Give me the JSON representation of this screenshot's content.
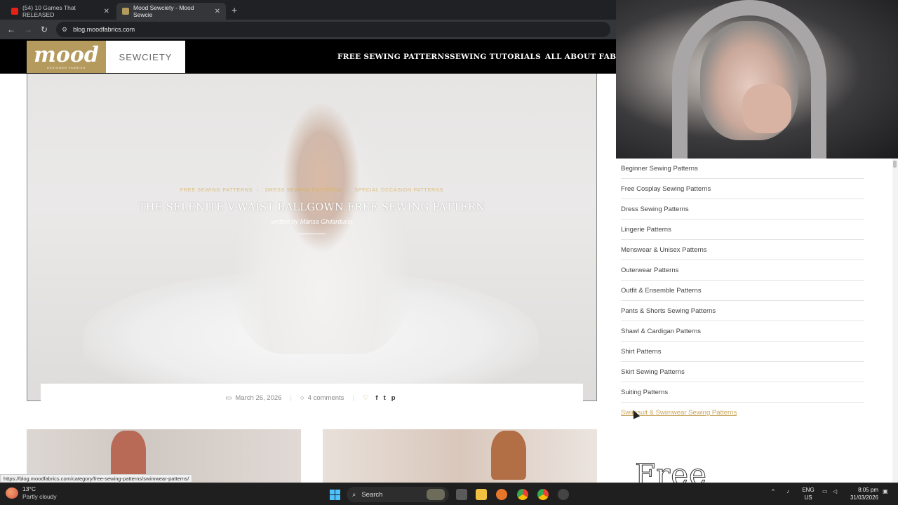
{
  "browser": {
    "tabs": [
      {
        "label": "(54) 10 Games That RELEASED",
        "close": "✕"
      },
      {
        "label": "Mood Sewciety - Mood Sewcie",
        "close": "✕"
      }
    ],
    "new_tab": "+",
    "url": "blog.moodfabrics.com"
  },
  "site": {
    "logo_main": "mood",
    "logo_sub": "DESIGNER FABRICS",
    "sewciety": "SEWCIETY",
    "menu": [
      "FREE SEWING PATTERNS",
      "SEWING TUTORIALS",
      "ALL ABOUT FABRIC"
    ]
  },
  "post": {
    "categories": [
      "FREE SEWING PATTERNS",
      "DRESS SEWING PATTERNS",
      "SPECIAL OCCASION PATTERNS"
    ],
    "title": "THE SELENITE V-WAIST BALLGOWN FREE SEWING PATTERN",
    "byline": "written by Marisa Ghilarducci",
    "date": "March 26, 2026",
    "comments": "4 comments"
  },
  "sidebar": {
    "items": [
      "Beginner Sewing Patterns",
      "Free Cosplay Sewing Patterns",
      "Dress Sewing Patterns",
      "Lingerie Patterns",
      "Menswear & Unisex Patterns",
      "Outerwear Patterns",
      "Outfit & Ensemble Patterns",
      "Pants & Shorts Sewing Patterns",
      "Shawl & Cardigan Patterns",
      "Shirt Patterns",
      "Skirt Sewing Patterns",
      "Suiting Patterns",
      "Swimsuit & Swimwear Sewing Patterns"
    ],
    "free_heading": "Free"
  },
  "status_url": "https://blog.moodfabrics.com/category/free-sewing-patterns/swimwear-patterns/",
  "taskbar": {
    "temperature": "13°C",
    "weather": "Partly cloudy",
    "search": "Search",
    "lang_top": "ENG",
    "lang_bottom": "US",
    "time": "8:05 pm",
    "date": "31/03/2026"
  },
  "colors": {
    "accent_gold": "#c9a55a",
    "logo_gold": "#b49a5c",
    "header_black": "#000000"
  }
}
